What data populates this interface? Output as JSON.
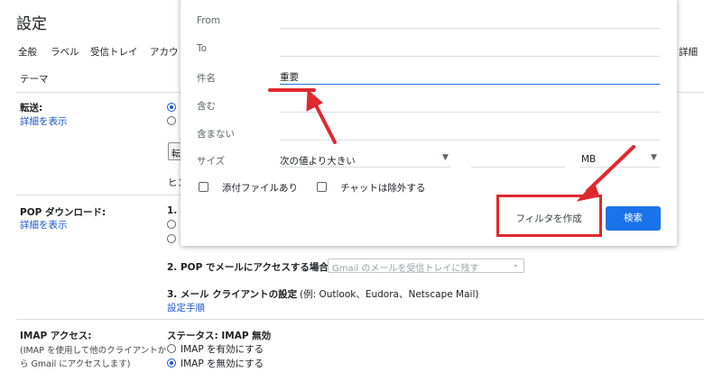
{
  "settings": {
    "title": "設定",
    "tabs": [
      "全般",
      "ラベル",
      "受信トレイ",
      "アカウ"
    ],
    "tabs_right": [
      "詳細"
    ],
    "tab_extra": "テーマ",
    "forwarding": {
      "label": "転送:",
      "link": "詳細を表示",
      "button_stub": "転",
      "hint_stub": "ヒン"
    },
    "pop": {
      "label": "POP ダウンロード:",
      "link": "詳細を表示",
      "step1_stub": "1.",
      "step2_label": "2. POP でメールにアクセスする場合",
      "step2_select": "Gmail のメールを受信トレイに残す",
      "step3_label": "3. メール クライアントの設定",
      "step3_example": "(例: Outlook、Eudora、Netscape Mail)",
      "step3_link": "設定手順"
    },
    "imap": {
      "label": "IMAP アクセス:",
      "desc_line1": "(IMAP を使用して他のクライアントか",
      "desc_line2": "ら Gmail にアクセスします)",
      "status": "ステータス: IMAP 無効",
      "enable": "IMAP を有効にする",
      "disable": "IMAP を無効にする"
    }
  },
  "filter_dialog": {
    "from_label": "From",
    "to_label": "To",
    "subject_label": "件名",
    "subject_value": "重要",
    "has_words_label": "含む",
    "not_words_label": "含まない",
    "size_label": "サイズ",
    "size_operator": "次の値より大きい",
    "size_unit": "MB",
    "has_attachment": "添付ファイルあり",
    "exclude_chats": "チャットは除外する",
    "create_filter_button": "フィルタを作成",
    "search_button": "検索"
  },
  "colors": {
    "accent": "#1a73e8",
    "link": "#1a57c8",
    "annotation": "#e0272f"
  }
}
